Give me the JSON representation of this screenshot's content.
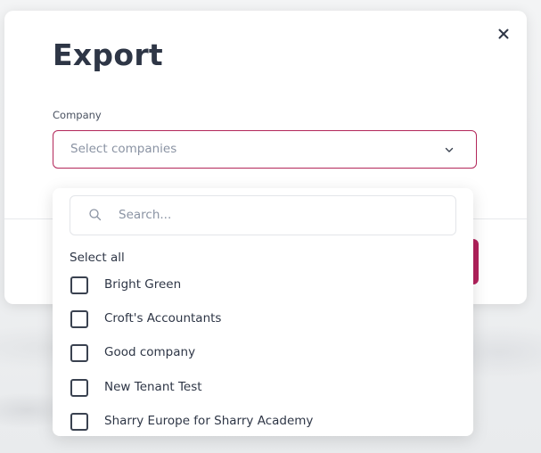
{
  "dialog": {
    "title": "Export",
    "close_icon": "close-icon"
  },
  "company_field": {
    "label": "Company",
    "placeholder": "Select companies",
    "chevron_icon": "chevron-down-icon"
  },
  "dropdown": {
    "search_placeholder": "Search...",
    "search_icon": "search-icon",
    "select_all_label": "Select all",
    "options": [
      {
        "label": "Bright Green",
        "checked": false
      },
      {
        "label": "Croft's Accountants",
        "checked": false
      },
      {
        "label": "Good company",
        "checked": false
      },
      {
        "label": "New Tenant Test",
        "checked": false
      },
      {
        "label": "Sharry Europe for Sharry Academy",
        "checked": false
      }
    ]
  },
  "colors": {
    "accent": "#b3275a",
    "text": "#2e3646"
  }
}
